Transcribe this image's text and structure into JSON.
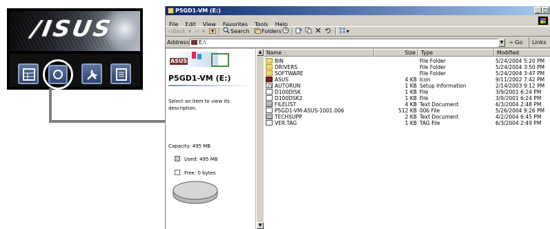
{
  "asus_panel": {
    "logo_text": "/ISUS",
    "menu_icons": [
      "drivers-icon",
      "utilities-cd-icon",
      "tools-icon",
      "manual-icon"
    ]
  },
  "window": {
    "title": "P5GD1-VM (E:)",
    "title_buttons": [
      "_",
      "□",
      "×"
    ],
    "menu": [
      "File",
      "Edit",
      "View",
      "Favorites",
      "Tools",
      "Help"
    ],
    "toolbar": {
      "back": "⇦Back",
      "forward": "⇨",
      "search": "Search",
      "folders": "Folders"
    },
    "address": {
      "label": "Address",
      "value": "E:\\",
      "go": "Go",
      "links": "Links"
    }
  },
  "info_pane": {
    "banner_label": "ASUS",
    "title": "P5GD1-VM (E:)",
    "description": "Select an item to view its description.",
    "capacity": "Capacity: 495 MB",
    "used": "Used: 495 MB",
    "free": "Free: 0 bytes"
  },
  "file_list": {
    "columns": {
      "name": "Name",
      "size": "Size",
      "type": "Type",
      "modified": "Modified"
    },
    "rows": [
      {
        "name": "BIN",
        "size": "",
        "type": "File Folder",
        "modified": "5/24/2004 5:20 PM",
        "icon": "folder-icon"
      },
      {
        "name": "DRIVERS",
        "size": "",
        "type": "File Folder",
        "modified": "5/24/2004 3:50 PM",
        "icon": "folder-icon"
      },
      {
        "name": "SOFTWARE",
        "size": "",
        "type": "File Folder",
        "modified": "5/24/2004 3:47 PM",
        "icon": "folder-icon"
      },
      {
        "name": "ASUS",
        "size": "4 KB",
        "type": "Icon",
        "modified": "9/11/2002 7:42 PM",
        "icon": "asus-icon"
      },
      {
        "name": "AUTORUN",
        "size": "1 KB",
        "type": "Setup Information",
        "modified": "2/14/2003 9:12 PM",
        "icon": "setup-icon"
      },
      {
        "name": "D100DISK",
        "size": "1 KB",
        "type": "File",
        "modified": "3/9/2001 6:24 PM",
        "icon": "file-icon"
      },
      {
        "name": "D100DSK2",
        "size": "1 KB",
        "type": "File",
        "modified": "3/9/2001 6:24 PM",
        "icon": "file-icon"
      },
      {
        "name": "FILELIST",
        "size": "4 KB",
        "type": "Text Document",
        "modified": "6/3/2004 2:48 PM",
        "icon": "text-doc-icon"
      },
      {
        "name": "P5GD1-VM-ASUS-1001.006",
        "size": "512 KB",
        "type": "006 File",
        "modified": "5/26/2004 9:26 PM",
        "icon": "file-icon"
      },
      {
        "name": "TECHSUPP",
        "size": "2 KB",
        "type": "Text Document",
        "modified": "4/2/2004 6:45 PM",
        "icon": "text-doc-icon"
      },
      {
        "name": "VER.TAG",
        "size": "1 KB",
        "type": "TAG File",
        "modified": "6/3/2004 2:49 PM",
        "icon": "file-icon"
      }
    ]
  },
  "colors": {
    "titlebar_start": "#0a246a",
    "titlebar_end": "#a6caf0",
    "window_face": "#d4d0c8",
    "connector": "#7f7f7f",
    "menu_button": "#2f4370"
  }
}
